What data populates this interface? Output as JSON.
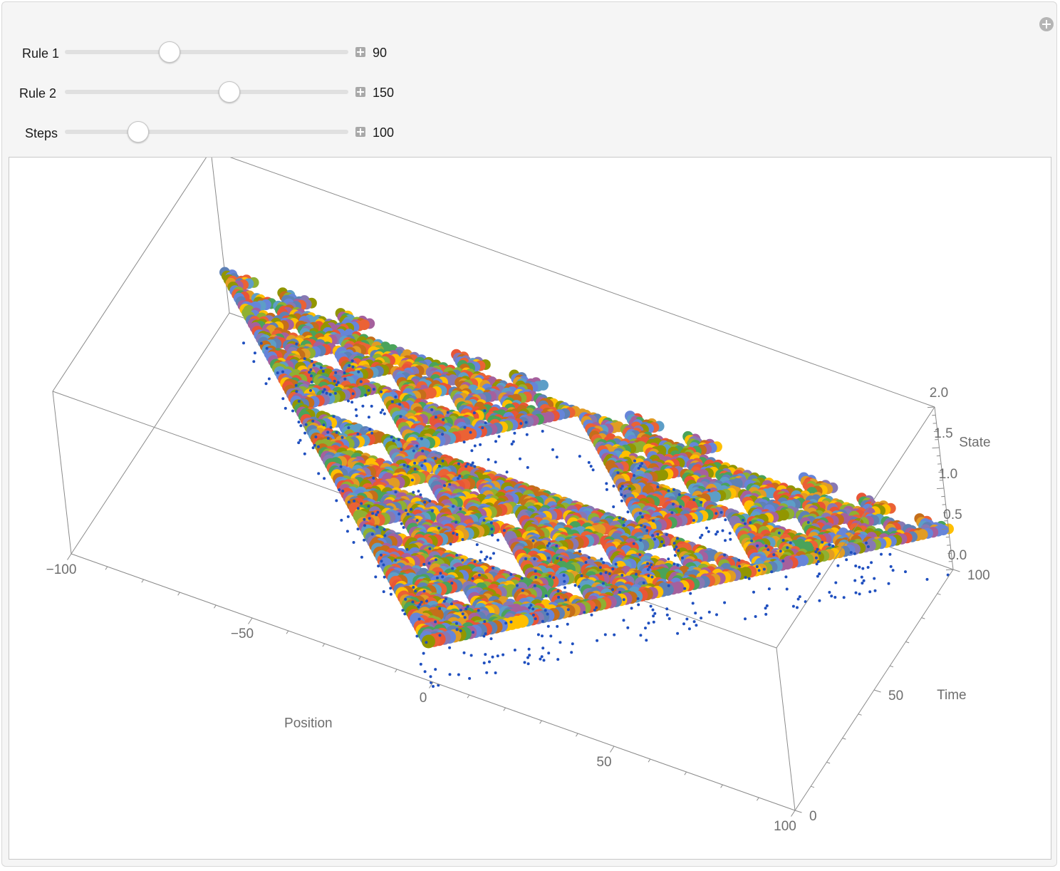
{
  "controls": [
    {
      "label": "Rule 1",
      "value": "90"
    },
    {
      "label": "Rule 2",
      "value": "150"
    },
    {
      "label": "Steps",
      "value": "100"
    }
  ],
  "sliders": {
    "rule1_fraction": 0.37,
    "rule2_fraction": 0.58,
    "steps_fraction": 0.26
  },
  "chart_data": {
    "type": "scatter",
    "title": "",
    "axes": {
      "position": {
        "label": "Position",
        "range": [
          -100,
          100
        ],
        "ticks": [
          "−100",
          "−50",
          "0",
          "50",
          "100"
        ]
      },
      "time": {
        "label": "Time",
        "range": [
          0,
          100
        ],
        "ticks": [
          "0",
          "50",
          "100"
        ]
      },
      "state": {
        "label": "State",
        "range": [
          0.0,
          2.0
        ],
        "ticks": [
          "0.0",
          "0.5",
          "1.0",
          "1.5",
          "2.0"
        ]
      }
    },
    "pattern": "cellular automaton evolution, rule 90 combined with rule 150, 100 steps from a single cell",
    "marker_colors": [
      "#5e81b5",
      "#e19c24",
      "#8fb032",
      "#eb6235",
      "#8778b3",
      "#c56e1a",
      "#5d9ec7",
      "#ffbf00",
      "#a5609d",
      "#929600",
      "#e95536",
      "#6685d9",
      "#4aa35a"
    ],
    "small_marker_color": "#1f4fbf",
    "grid": false
  }
}
